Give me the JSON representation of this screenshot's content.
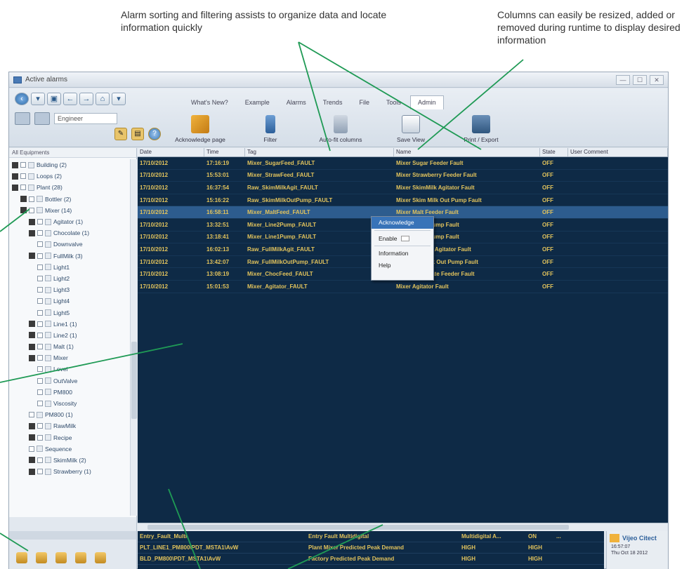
{
  "callouts": {
    "top_left": "Alarm sorting and filtering assists to organize data and locate information quickly",
    "top_right": "Columns can easily be resized, added or removed during runtime to display desired information"
  },
  "window": {
    "title": "Active alarms",
    "controls": [
      "—",
      "☐",
      "✕"
    ]
  },
  "ribbon": {
    "user": "Engineer",
    "tabs": [
      "What's New?",
      "Example",
      "Alarms",
      "Trends",
      "File",
      "Tools",
      "Admin"
    ],
    "active_tab": "Admin",
    "tools": [
      {
        "label": "Acknowledge page",
        "icon": "acknowledge-icon"
      },
      {
        "label": "Filter",
        "icon": "filter-icon"
      },
      {
        "label": "Auto-fit columns",
        "icon": "autofit-icon"
      },
      {
        "label": "Save View",
        "icon": "save-view-icon"
      },
      {
        "label": "Print / Export",
        "icon": "print-icon"
      }
    ]
  },
  "tree": {
    "header": "All Equipments",
    "items": [
      {
        "label": "Building (2)",
        "depth": 0,
        "expand": true
      },
      {
        "label": "Loops (2)",
        "depth": 0,
        "expand": true
      },
      {
        "label": "Plant (28)",
        "depth": 0,
        "expand": true
      },
      {
        "label": "Bottler (2)",
        "depth": 1,
        "expand": true
      },
      {
        "label": "Mixer (14)",
        "depth": 1,
        "expand": true
      },
      {
        "label": "Agitator (1)",
        "depth": 2,
        "expand": true
      },
      {
        "label": "Chocolate (1)",
        "depth": 2,
        "expand": true
      },
      {
        "label": "Downvalve",
        "depth": 3,
        "expand": false
      },
      {
        "label": "FullMilk (3)",
        "depth": 2,
        "expand": true
      },
      {
        "label": "Light1",
        "depth": 3,
        "expand": false
      },
      {
        "label": "Light2",
        "depth": 3,
        "expand": false
      },
      {
        "label": "Light3",
        "depth": 3,
        "expand": false
      },
      {
        "label": "Light4",
        "depth": 3,
        "expand": false
      },
      {
        "label": "Light5",
        "depth": 3,
        "expand": false
      },
      {
        "label": "Line1 (1)",
        "depth": 2,
        "expand": true
      },
      {
        "label": "Line2 (1)",
        "depth": 2,
        "expand": true
      },
      {
        "label": "Malt (1)",
        "depth": 2,
        "expand": true
      },
      {
        "label": "Mixer",
        "depth": 2,
        "expand": true
      },
      {
        "label": "Level",
        "depth": 3,
        "expand": false
      },
      {
        "label": "OutValve",
        "depth": 3,
        "expand": false
      },
      {
        "label": "PM800",
        "depth": 3,
        "expand": false
      },
      {
        "label": "Viscosity",
        "depth": 3,
        "expand": false
      },
      {
        "label": "PM800 (1)",
        "depth": 2,
        "expand": false
      },
      {
        "label": "RawMilk",
        "depth": 2,
        "expand": true
      },
      {
        "label": "Recipe",
        "depth": 2,
        "expand": true
      },
      {
        "label": "Sequence",
        "depth": 2,
        "expand": false
      },
      {
        "label": "SkimMilk (2)",
        "depth": 2,
        "expand": true
      },
      {
        "label": "Strawberry (1)",
        "depth": 2,
        "expand": true
      }
    ]
  },
  "grid": {
    "columns": [
      "Date",
      "Time",
      "Tag",
      "Name",
      "State",
      "User Comment"
    ],
    "rows": [
      {
        "date": "17/10/2012",
        "time": "17:16:19",
        "tag": "Mixer_SugarFeed_FAULT",
        "name": "Mixer Sugar Feeder Fault",
        "state": "OFF"
      },
      {
        "date": "17/10/2012",
        "time": "15:53:01",
        "tag": "Mixer_StrawFeed_FAULT",
        "name": "Mixer Strawberry Feeder Fault",
        "state": "OFF"
      },
      {
        "date": "17/10/2012",
        "time": "16:37:54",
        "tag": "Raw_SkimMilkAgit_FAULT",
        "name": "Mixer SkimMilk Agitator Fault",
        "state": "OFF"
      },
      {
        "date": "17/10/2012",
        "time": "15:16:22",
        "tag": "Raw_SkimMilkOutPump_FAULT",
        "name": "Mixer Skim Milk Out Pump Fault",
        "state": "OFF"
      },
      {
        "date": "17/10/2012",
        "time": "16:58:11",
        "tag": "Mixer_MaltFeed_FAULT",
        "name": "Mixer Malt Feeder Fault",
        "state": "OFF"
      },
      {
        "date": "17/10/2012",
        "time": "13:32:51",
        "tag": "Mixer_Line2Pump_FAULT",
        "name": "Mixer Line2 Pump Fault",
        "state": "OFF"
      },
      {
        "date": "17/10/2012",
        "time": "13:18:41",
        "tag": "Mixer_Line1Pump_FAULT",
        "name": "Mixer Line1 Pump Fault",
        "state": "OFF"
      },
      {
        "date": "17/10/2012",
        "time": "16:02:13",
        "tag": "Raw_FullMilkAgit_FAULT",
        "name": "Mixer FullMilk Agitator Fault",
        "state": "OFF"
      },
      {
        "date": "17/10/2012",
        "time": "13:42:07",
        "tag": "Raw_FullMilkOutPump_FAULT",
        "name": "Mixer Full Milk Out Pump Fault",
        "state": "OFF"
      },
      {
        "date": "17/10/2012",
        "time": "13:08:19",
        "tag": "Mixer_ChocFeed_FAULT",
        "name": "Mixer Chocolate Feeder Fault",
        "state": "OFF"
      },
      {
        "date": "17/10/2012",
        "time": "15:01:53",
        "tag": "Mixer_Agitator_FAULT",
        "name": "Mixer Agitator Fault",
        "state": "OFF"
      }
    ],
    "selected_row": 4
  },
  "context_menu": {
    "items": [
      "Acknowledge",
      "Enable",
      "Information",
      "Help"
    ]
  },
  "summary": {
    "rows": [
      {
        "c1": "Entry_Fault_Multi",
        "c2": "Entry Fault Multidigital",
        "c3": "Multidigital A...",
        "c4": "ON",
        "c5": "..."
      },
      {
        "c1": "PLT_LINE1_PM800\\PDT_MSTA1\\AvW",
        "c2": "Plant Mixer Predicted Peak Demand",
        "c3": "HIGH",
        "c4": "HIGH",
        "c5": ""
      },
      {
        "c1": "BLD_PM800\\PDT_MSTA1\\AvW",
        "c2": "Factory Predicted Peak Demand",
        "c3": "HIGH",
        "c4": "HIGH",
        "c5": ""
      }
    ]
  },
  "logo": {
    "brand": "Vijeo Citect",
    "time": "16:57:07",
    "date": "Thu Oct 18 2012"
  },
  "colors": {
    "grid_bg": "#0e2a46",
    "alarm_text": "#e2c35c",
    "selected_row": "#2d5c8e",
    "callout_line": "#1f9a55"
  }
}
